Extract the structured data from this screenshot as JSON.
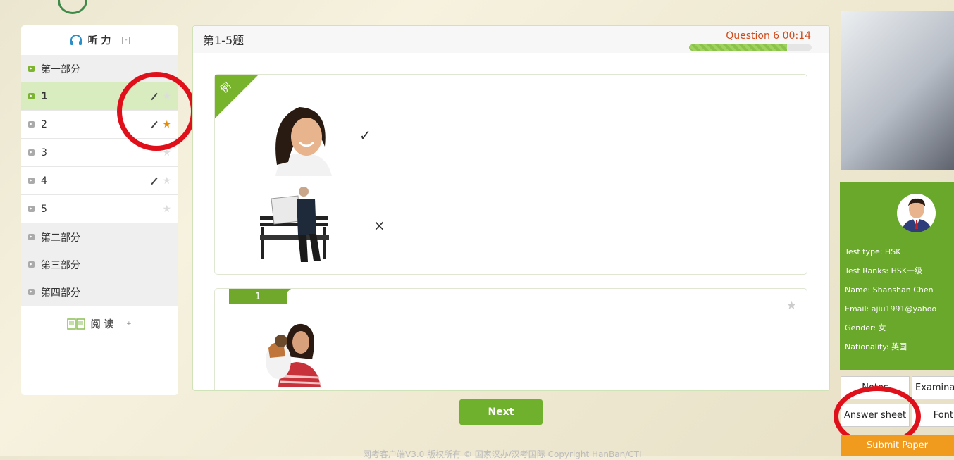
{
  "nav": {
    "listening_title": "听 力",
    "collapse_symbol": "-",
    "expand_symbol": "+",
    "sections": [
      "第一部分",
      "第二部分",
      "第三部分",
      "第四部分"
    ],
    "items": [
      "1",
      "2",
      "3",
      "4",
      "5"
    ],
    "reading_title": "阅 读"
  },
  "main": {
    "heading": "第1-5题",
    "question_info": "Question 6 00:14",
    "progress_fraction": 0.8,
    "example_tag": "例",
    "check_symbol": "✓",
    "cross_symbol": "×",
    "question_tag": "1",
    "next_label": "Next"
  },
  "footer": "网考客户端V3.0 版权所有 © 国家汉办/汉考国际 Copyright HanBan/CTI",
  "profile": {
    "test_type": "Test type: HSK",
    "test_ranks": "Test Ranks: HSK一级",
    "name": "Name: Shanshan Chen",
    "email": "Email: ajiu1991@yahoo",
    "gender": "Gender: 女",
    "nationality": "Nationality: 英国"
  },
  "buttons": {
    "notes": "Notes",
    "examination": "Examination",
    "answer_sheet": "Answer sheet",
    "font": "Font",
    "submit": "Submit Paper"
  },
  "colors": {
    "accent": "#6fb12c",
    "alert": "#e0101b",
    "submit": "#f09a1e"
  }
}
